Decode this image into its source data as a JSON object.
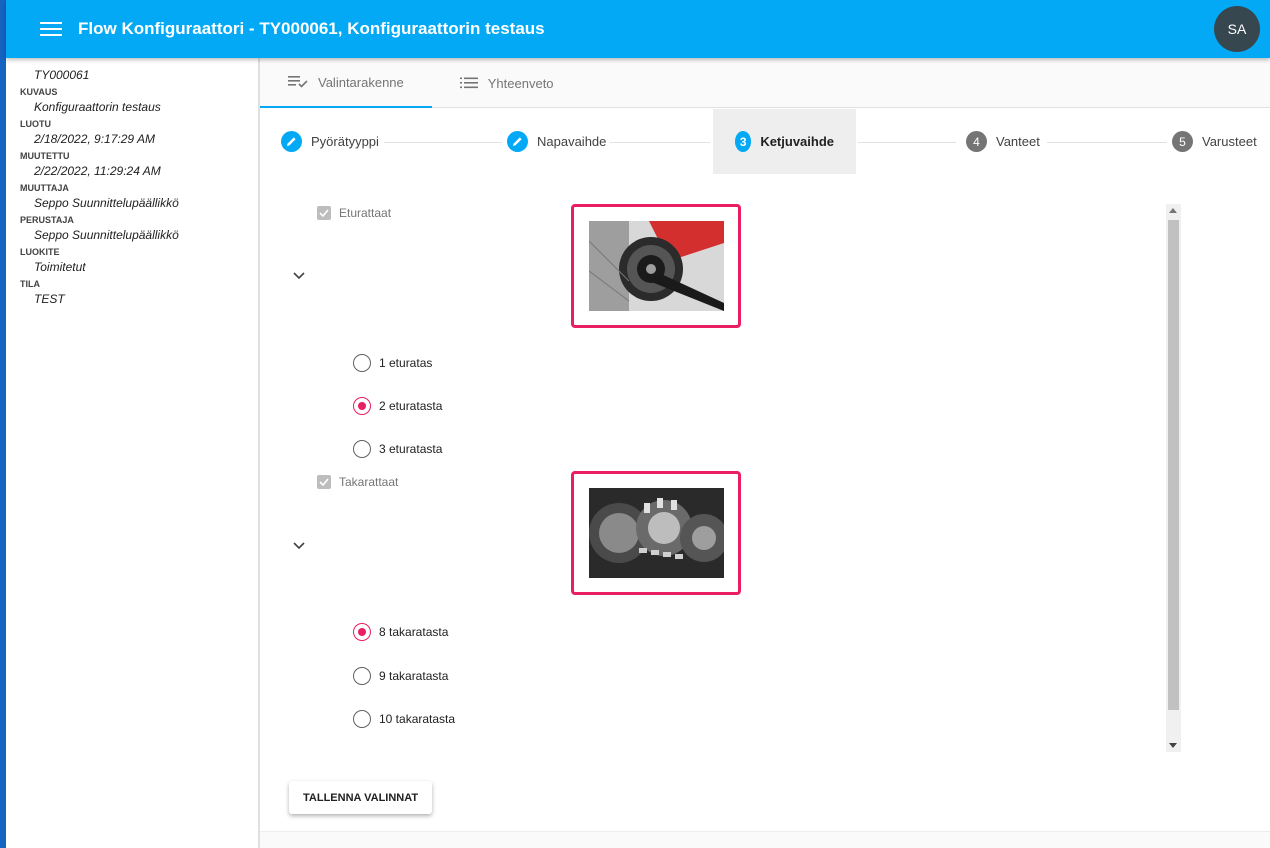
{
  "header": {
    "title": "Flow Konfiguraattori - TY000061, Konfiguraattorin testaus",
    "avatar": "SA"
  },
  "sidebar": {
    "items": [
      {
        "label": "",
        "value": "TY000061"
      },
      {
        "label": "KUVAUS",
        "value": "Konfiguraattorin testaus"
      },
      {
        "label": "LUOTU",
        "value": "2/18/2022, 9:17:29 AM"
      },
      {
        "label": "MUUTETTU",
        "value": "2/22/2022, 11:29:24 AM"
      },
      {
        "label": "MUUTTAJA",
        "value": "Seppo Suunnittelupäällikkö"
      },
      {
        "label": "PERUSTAJA",
        "value": "Seppo Suunnittelupäällikkö"
      },
      {
        "label": "LUOKITE",
        "value": "Toimitetut"
      },
      {
        "label": "TILA",
        "value": "TEST"
      }
    ]
  },
  "tabs": [
    {
      "label": "Valintarakenne",
      "icon": "playlist-check-icon",
      "active": true
    },
    {
      "label": "Yhteenveto",
      "icon": "list-icon",
      "active": false
    }
  ],
  "steps": [
    {
      "label": "Pyörätyyppi",
      "marker": "edit",
      "state": "done"
    },
    {
      "label": "Napavaihde",
      "marker": "edit",
      "state": "done"
    },
    {
      "label": "Ketjuvaihde",
      "marker": "3",
      "state": "active"
    },
    {
      "label": "Vanteet",
      "marker": "4",
      "state": "pending"
    },
    {
      "label": "Varusteet",
      "marker": "5",
      "state": "pending"
    }
  ],
  "groups": [
    {
      "label": "Eturattaat",
      "checked": true,
      "image": "chainring-photo",
      "options": [
        {
          "label": "1 eturatas",
          "selected": false
        },
        {
          "label": "2 eturatasta",
          "selected": true
        },
        {
          "label": "3 eturatasta",
          "selected": false
        }
      ]
    },
    {
      "label": "Takarattaat",
      "checked": true,
      "image": "cassette-photo",
      "options": [
        {
          "label": "8 takaratasta",
          "selected": true
        },
        {
          "label": "9 takaratasta",
          "selected": false
        },
        {
          "label": "10 takaratasta",
          "selected": false
        }
      ]
    }
  ],
  "actions": {
    "save_label": "TALLENNA VALINNAT"
  },
  "colors": {
    "primary": "#03a9f4",
    "accent": "#e91e63",
    "edge": "#1565c0",
    "avatar": "#37474f"
  }
}
